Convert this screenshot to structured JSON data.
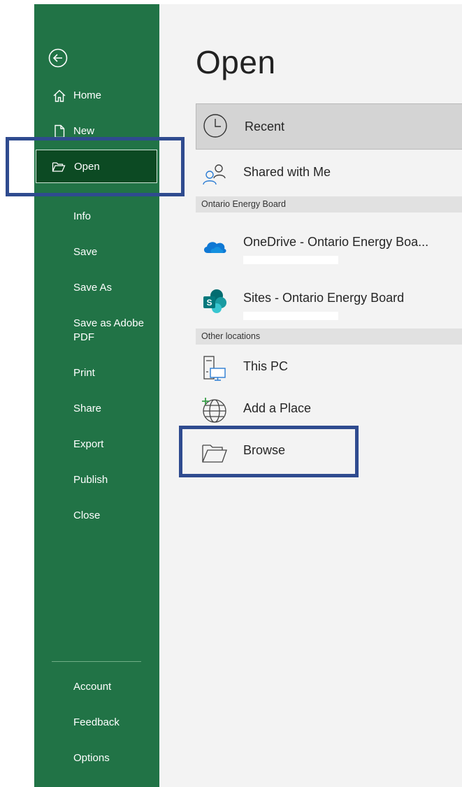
{
  "nav": {
    "back_icon": "back-arrow-icon",
    "items": [
      {
        "label": "Home",
        "icon": "home-icon"
      },
      {
        "label": "New",
        "icon": "new-document-icon"
      },
      {
        "label": "Open",
        "icon": "folder-open-icon"
      }
    ],
    "text_items": [
      "Info",
      "Save",
      "Save As",
      "Save as Adobe PDF",
      "Print",
      "Share",
      "Export",
      "Publish",
      "Close"
    ],
    "bottom_items": [
      "Account",
      "Feedback",
      "Options"
    ],
    "selected": "Open",
    "colors": {
      "background": "#217346",
      "selected": "#0c4a23"
    }
  },
  "main": {
    "title": "Open",
    "locations": [
      {
        "label": "Recent",
        "icon": "clock-icon"
      },
      {
        "label": "Shared with Me",
        "icon": "shared-people-icon"
      }
    ],
    "org_section": {
      "header": "Ontario Energy Board",
      "items": [
        {
          "label": "OneDrive - Ontario Energy Boa...",
          "icon": "onedrive-cloud-icon"
        },
        {
          "label": "Sites - Ontario Energy Board",
          "icon": "sharepoint-icon"
        }
      ]
    },
    "other_section": {
      "header": "Other locations",
      "items": [
        {
          "label": "This PC",
          "icon": "this-pc-icon"
        },
        {
          "label": "Add a Place",
          "icon": "add-place-globe-icon"
        },
        {
          "label": "Browse",
          "icon": "browse-folder-icon"
        }
      ]
    }
  },
  "annotations": {
    "highlight_color": "#2f4b8f",
    "highlighted": [
      "Open",
      "Browse"
    ]
  }
}
